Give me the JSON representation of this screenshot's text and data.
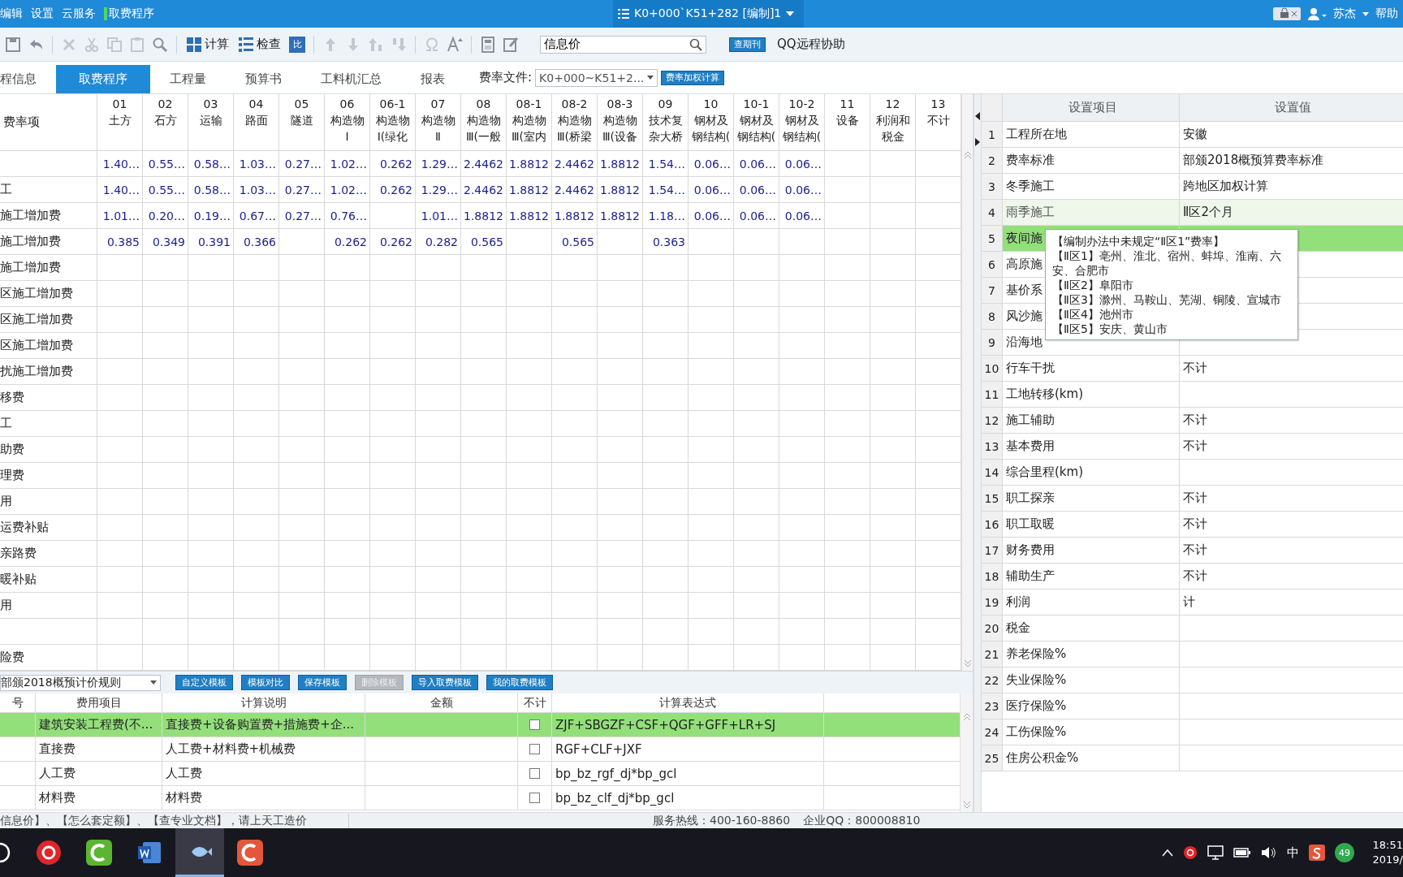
{
  "title_bar": {
    "menu": [
      "编辑",
      "设置",
      "云服务",
      "取费程序"
    ],
    "document_tab": "K0+000`K51+282 [编制]1",
    "user": "苏杰",
    "help": "帮助"
  },
  "toolbar": {
    "calc": "计算",
    "check": "检查",
    "compare": "比",
    "search_value": "信息价",
    "journal_button": "查期刊",
    "remote": "QQ远程协助"
  },
  "tabs": [
    {
      "label": "程信息",
      "selected": false
    },
    {
      "label": "取费程序",
      "selected": true
    },
    {
      "label": "工程量",
      "selected": false
    },
    {
      "label": "预算书",
      "selected": false
    },
    {
      "label": "工料机汇总",
      "selected": false
    },
    {
      "label": "报表",
      "selected": false
    }
  ],
  "fee_file": {
    "label": "费率文件:",
    "value": "K0+000~K51+2...",
    "button": "费率加权计算"
  },
  "rate_table": {
    "label_header": "费率项",
    "columns": [
      {
        "code": "01",
        "name": [
          "土方"
        ]
      },
      {
        "code": "02",
        "name": [
          "石方"
        ]
      },
      {
        "code": "03",
        "name": [
          "运输"
        ]
      },
      {
        "code": "04",
        "name": [
          "路面"
        ]
      },
      {
        "code": "05",
        "name": [
          "隧道"
        ]
      },
      {
        "code": "06",
        "name": [
          "构造物",
          "Ⅰ"
        ]
      },
      {
        "code": "06-1",
        "name": [
          "构造物",
          "Ⅰ(绿化"
        ]
      },
      {
        "code": "07",
        "name": [
          "构造物",
          "Ⅱ"
        ]
      },
      {
        "code": "08",
        "name": [
          "构造物",
          "Ⅲ(一般"
        ]
      },
      {
        "code": "08-1",
        "name": [
          "构造物",
          "Ⅲ(室内"
        ]
      },
      {
        "code": "08-2",
        "name": [
          "构造物",
          "Ⅲ(桥梁"
        ]
      },
      {
        "code": "08-3",
        "name": [
          "构造物",
          "Ⅲ(设备"
        ]
      },
      {
        "code": "09",
        "name": [
          "技术复",
          "杂大桥"
        ]
      },
      {
        "code": "10",
        "name": [
          "钢材及",
          "钢结构("
        ]
      },
      {
        "code": "10-1",
        "name": [
          "钢材及",
          "钢结构("
        ]
      },
      {
        "code": "10-2",
        "name": [
          "钢材及",
          "钢结构("
        ]
      },
      {
        "code": "11",
        "name": [
          "设备"
        ]
      },
      {
        "code": "12",
        "name": [
          "利润和",
          "税金"
        ]
      },
      {
        "code": "13",
        "name": [
          "不计"
        ]
      }
    ],
    "rows": [
      {
        "values": {
          "01": "1.40…",
          "02": "0.55…",
          "03": "0.58…",
          "04": "1.03…",
          "05": "0.27…",
          "06": "1.02…",
          "06-1": "0.262",
          "07": "1.29…",
          "08": "2.4462",
          "08-1": "1.8812",
          "08-2": "2.4462",
          "08-3": "1.8812",
          "09": "1.54…",
          "10": "0.06…",
          "10-1": "0.06…",
          "10-2": "0.06…"
        }
      },
      {
        "label": "工",
        "values": {
          "01": "1.40…",
          "02": "0.55…",
          "03": "0.58…",
          "04": "1.03…",
          "05": "0.27…",
          "06": "1.02…",
          "06-1": "0.262",
          "07": "1.29…",
          "08": "2.4462",
          "08-1": "1.8812",
          "08-2": "2.4462",
          "08-3": "1.8812",
          "09": "1.54…",
          "10": "0.06…",
          "10-1": "0.06…",
          "10-2": "0.06…"
        }
      },
      {
        "label": "施工增加费",
        "values": {
          "01": "1.01…",
          "02": "0.20…",
          "03": "0.19…",
          "04": "0.67…",
          "05": "0.27…",
          "06": "0.76…",
          "07": "1.01…",
          "08": "1.8812",
          "08-1": "1.8812",
          "08-2": "1.8812",
          "08-3": "1.8812",
          "09": "1.18…",
          "10": "0.06…",
          "10-1": "0.06…",
          "10-2": "0.06…"
        }
      },
      {
        "label": "施工增加费",
        "values": {
          "01": "0.385",
          "02": "0.349",
          "03": "0.391",
          "04": "0.366",
          "06": "0.262",
          "06-1": "0.262",
          "07": "0.282",
          "08": "0.565",
          "08-2": "0.565",
          "09": "0.363"
        }
      },
      {
        "label": "施工增加费"
      },
      {
        "label": "区施工增加费"
      },
      {
        "label": "区施工增加费"
      },
      {
        "label": "区施工增加费"
      },
      {
        "label": "扰施工增加费"
      },
      {
        "label": "移费"
      },
      {
        "label": "工"
      },
      {
        "label": "助费"
      },
      {
        "label": "理费"
      },
      {
        "label": "用"
      },
      {
        "label": "运费补贴"
      },
      {
        "label": "亲路费"
      },
      {
        "label": "暖补贴"
      },
      {
        "label": "用"
      },
      {},
      {
        "label": "险费"
      }
    ]
  },
  "template_bar": {
    "rule": "部颁2018概预计价规则",
    "buttons": [
      {
        "label": "自定义模板",
        "disabled": false
      },
      {
        "label": "模板对比",
        "disabled": false
      },
      {
        "label": "保存模板",
        "disabled": false
      },
      {
        "label": "删除模板",
        "disabled": true
      },
      {
        "label": "导入取费模板",
        "disabled": false
      },
      {
        "label": "我的取费模板",
        "disabled": false
      }
    ]
  },
  "fee_table": {
    "columns": [
      "号",
      "费用项目",
      "计算说明",
      "金额",
      "不计",
      "计算表达式"
    ],
    "rows": [
      {
        "selected": true,
        "item": "建筑安装工程费(不...",
        "description": "直接费+设备购置费+措施费+企...",
        "excluded": false,
        "expression": "ZJF+SBGZF+CSF+QGF+GFF+LR+SJ"
      },
      {
        "selected": false,
        "item": "直接费",
        "description": "人工费+材料费+机械费",
        "excluded": false,
        "expression": "RGF+CLF+JXF"
      },
      {
        "selected": false,
        "item": "人工费",
        "description": "人工费",
        "excluded": false,
        "expression": "bp_bz_rgf_dj*bp_gcl"
      },
      {
        "selected": false,
        "item": "材料费",
        "description": "材料费",
        "excluded": false,
        "expression": "bp_bz_clf_dj*bp_gcl"
      }
    ]
  },
  "settings": {
    "columns": [
      "设置项目",
      "设置值"
    ],
    "rows": [
      {
        "no": "1",
        "item": "工程所在地",
        "value": "安徽",
        "selected": false,
        "hovered": false
      },
      {
        "no": "2",
        "item": "费率标准",
        "value": "部颁2018概预算费率标准",
        "selected": false,
        "hovered": false
      },
      {
        "no": "3",
        "item": "冬季施工",
        "value": "跨地区加权计算",
        "selected": false,
        "hovered": false
      },
      {
        "no": "4",
        "item": "雨季施工",
        "value": "Ⅱ区2个月",
        "selected": false,
        "hovered": true
      },
      {
        "no": "5",
        "item": "夜间施",
        "selected": true,
        "hovered": false
      },
      {
        "no": "6",
        "item": "高原施",
        "selected": false,
        "hovered": false
      },
      {
        "no": "7",
        "item": "基价系",
        "selected": false,
        "hovered": false
      },
      {
        "no": "8",
        "item": "风沙施",
        "selected": false,
        "hovered": false
      },
      {
        "no": "9",
        "item": "沿海地",
        "selected": false,
        "hovered": false
      },
      {
        "no": "10",
        "item": "行车干扰",
        "value": "不计",
        "selected": false,
        "hovered": false
      },
      {
        "no": "11",
        "item": "工地转移(km)",
        "selected": false,
        "hovered": false
      },
      {
        "no": "12",
        "item": "施工辅助",
        "value": "不计",
        "selected": false,
        "hovered": false
      },
      {
        "no": "13",
        "item": "基本费用",
        "value": "不计",
        "selected": false,
        "hovered": false
      },
      {
        "no": "14",
        "item": "综合里程(km)",
        "selected": false,
        "hovered": false
      },
      {
        "no": "15",
        "item": "职工探亲",
        "value": "不计",
        "selected": false,
        "hovered": false
      },
      {
        "no": "16",
        "item": "职工取暖",
        "value": "不计",
        "selected": false,
        "hovered": false
      },
      {
        "no": "17",
        "item": "财务费用",
        "value": "不计",
        "selected": false,
        "hovered": false
      },
      {
        "no": "18",
        "item": "辅助生产",
        "value": "不计",
        "selected": false,
        "hovered": false
      },
      {
        "no": "19",
        "item": "利润",
        "value": "计",
        "selected": false,
        "hovered": false
      },
      {
        "no": "20",
        "item": "税金",
        "selected": false,
        "hovered": false
      },
      {
        "no": "21",
        "item": "养老保险%",
        "selected": false,
        "hovered": false
      },
      {
        "no": "22",
        "item": "失业保险%",
        "selected": false,
        "hovered": false
      },
      {
        "no": "23",
        "item": "医疗保险%",
        "selected": false,
        "hovered": false
      },
      {
        "no": "24",
        "item": "工伤保险%",
        "selected": false,
        "hovered": false
      },
      {
        "no": "25",
        "item": "住房公积金%",
        "selected": false,
        "hovered": false
      }
    ],
    "tooltip": [
      "【编制办法中未规定“Ⅱ区1”费率】",
      "【Ⅱ区1】亳州、淮北、宿州、蚌埠、淮南、六安、合肥市",
      "【Ⅱ区2】阜阳市",
      "【Ⅱ区3】滁州、马鞍山、芜湖、铜陵、宣城市",
      "【Ⅱ区4】池州市",
      "【Ⅱ区5】安庆、黄山市"
    ]
  },
  "status_bar": {
    "message": "信息价】、【怎么套定额】、【查专业文档】，请上天工造价",
    "hotline": "服务热线：400-160-8860",
    "qq": "企业QQ：800008810"
  },
  "taskbar": {
    "ime": "中",
    "badge": "49",
    "time": "18:51",
    "date": "2019/"
  }
}
